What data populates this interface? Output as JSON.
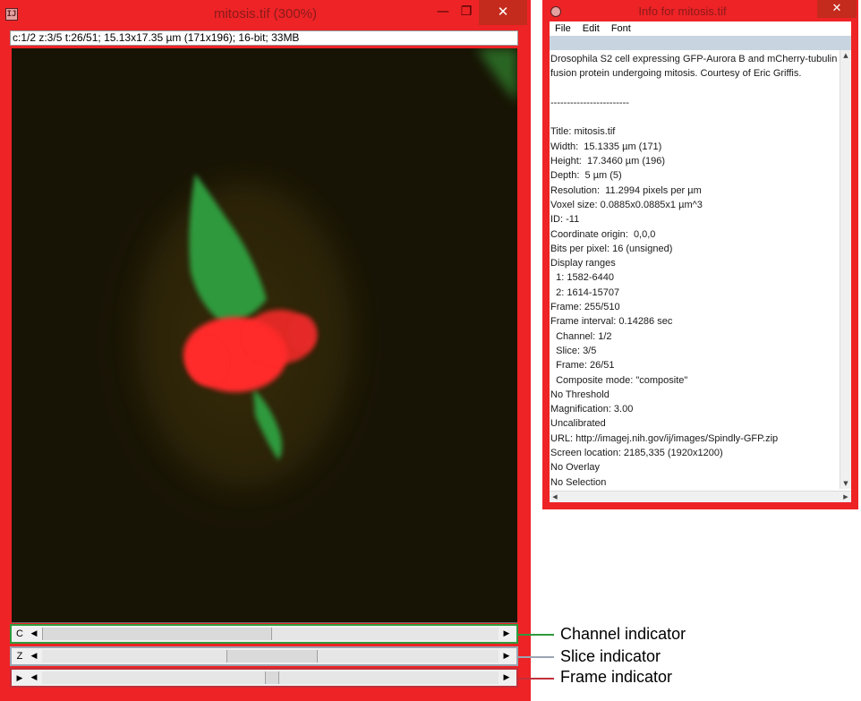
{
  "image_window": {
    "title": "mitosis.tif (300%)",
    "info_bar": "c:1/2 z:3/5 t:26/51; 15.13x17.35 µm (171x196); 16-bit; 33MB",
    "app_icon": "imagej-icon",
    "controls": {
      "minimize": "—",
      "maximize": "❐",
      "close": "✕"
    },
    "sliders": [
      {
        "label": "C",
        "value": 1,
        "max": 2
      },
      {
        "label": "Z",
        "value": 3,
        "max": 5
      },
      {
        "label": "▶",
        "value": 26,
        "max": 51
      }
    ]
  },
  "info_window": {
    "title": "Info for mitosis.tif",
    "menu": [
      "File",
      "Edit",
      "Font"
    ],
    "lines": [
      "Drosophila S2 cell expressing GFP-Aurora B and mCherry-tubulin",
      "fusion protein undergoing mitosis. Courtesy of Eric Griffis.",
      "",
      "------------------------",
      "",
      "Title: mitosis.tif",
      "Width:  15.1335 µm (171)",
      "Height:  17.3460 µm (196)",
      "Depth:  5 µm (5)",
      "Resolution:  11.2994 pixels per µm",
      "Voxel size: 0.0885x0.0885x1 µm^3",
      "ID: -11",
      "Coordinate origin:  0,0,0",
      "Bits per pixel: 16 (unsigned)",
      "Display ranges",
      "  1: 1582-6440",
      "  2: 1614-15707",
      "Frame: 255/510",
      "Frame interval: 0.14286 sec",
      "  Channel: 1/2",
      "  Slice: 3/5",
      "  Frame: 26/51",
      "  Composite mode: \"composite\"",
      "No Threshold",
      "Magnification: 3.00",
      "Uncalibrated",
      "URL: http://imagej.nih.gov/ij/images/Spindly-GFP.zip",
      "Screen location: 2185,335 (1920x1200)",
      "No Overlay",
      "No Selection"
    ]
  },
  "callouts": [
    {
      "text": "Channel indicator",
      "color": "#2f9a3c"
    },
    {
      "text": "Slice indicator",
      "color": "#9aa5b1"
    },
    {
      "text": "Frame indicator",
      "color": "#c0303a"
    }
  ],
  "colors": {
    "window_frame": "#ee2326",
    "image_background": "#181405",
    "green_channel": "#2f9a3c",
    "red_channel": "#ff2b2b"
  }
}
